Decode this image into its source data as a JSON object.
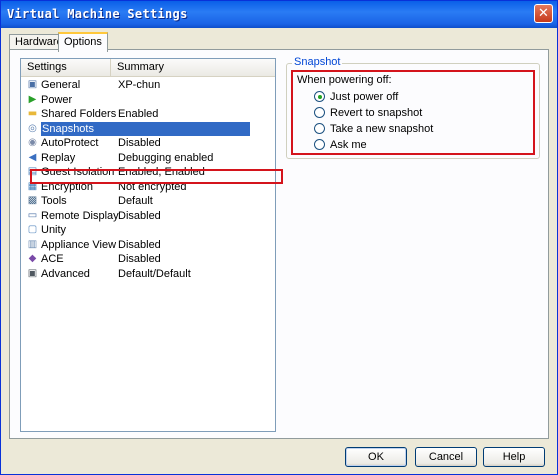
{
  "window": {
    "title": "Virtual Machine Settings",
    "close_glyph": "✕"
  },
  "tabs": [
    {
      "label": "Hardware"
    },
    {
      "label": "Options",
      "active": true
    }
  ],
  "settings_list": {
    "columns": {
      "settings": "Settings",
      "summary": "Summary"
    },
    "rows": [
      {
        "label": "General",
        "summary": "XP-chun",
        "icon": "general-icon"
      },
      {
        "label": "Power",
        "summary": "",
        "icon": "power-icon"
      },
      {
        "label": "Shared Folders",
        "summary": "Enabled",
        "icon": "folder-icon"
      },
      {
        "label": "Snapshots",
        "summary": "",
        "icon": "snapshot-icon",
        "selected": true
      },
      {
        "label": "AutoProtect",
        "summary": "Disabled",
        "icon": "autoprotect-icon"
      },
      {
        "label": "Replay",
        "summary": "Debugging enabled",
        "icon": "replay-icon"
      },
      {
        "label": "Guest Isolation",
        "summary": "Enabled, Enabled",
        "icon": "isolation-icon"
      },
      {
        "label": "Encryption",
        "summary": "Not encrypted",
        "icon": "encryption-icon"
      },
      {
        "label": "Tools",
        "summary": "Default",
        "icon": "tools-icon"
      },
      {
        "label": "Remote Display",
        "summary": "Disabled",
        "icon": "remote-display-icon"
      },
      {
        "label": "Unity",
        "summary": "",
        "icon": "unity-icon"
      },
      {
        "label": "Appliance View",
        "summary": "Disabled",
        "icon": "appliance-icon"
      },
      {
        "label": "ACE",
        "summary": "Disabled",
        "icon": "ace-icon"
      },
      {
        "label": "Advanced",
        "summary": "Default/Default",
        "icon": "advanced-icon"
      }
    ]
  },
  "snapshot_panel": {
    "group_label": "Snapshot",
    "prompt": "When powering off:",
    "options": [
      {
        "label": "Just power off",
        "checked": true
      },
      {
        "label": "Revert to snapshot",
        "checked": false
      },
      {
        "label": "Take a new snapshot",
        "checked": false
      },
      {
        "label": "Ask me",
        "checked": false
      }
    ]
  },
  "buttons": {
    "ok": "OK",
    "cancel": "Cancel",
    "help": "Help"
  },
  "colors": {
    "titlebar": "#0a5fe8",
    "selection": "#316ac5",
    "highlight_box": "#d4141c",
    "group_label": "#0046d5"
  }
}
